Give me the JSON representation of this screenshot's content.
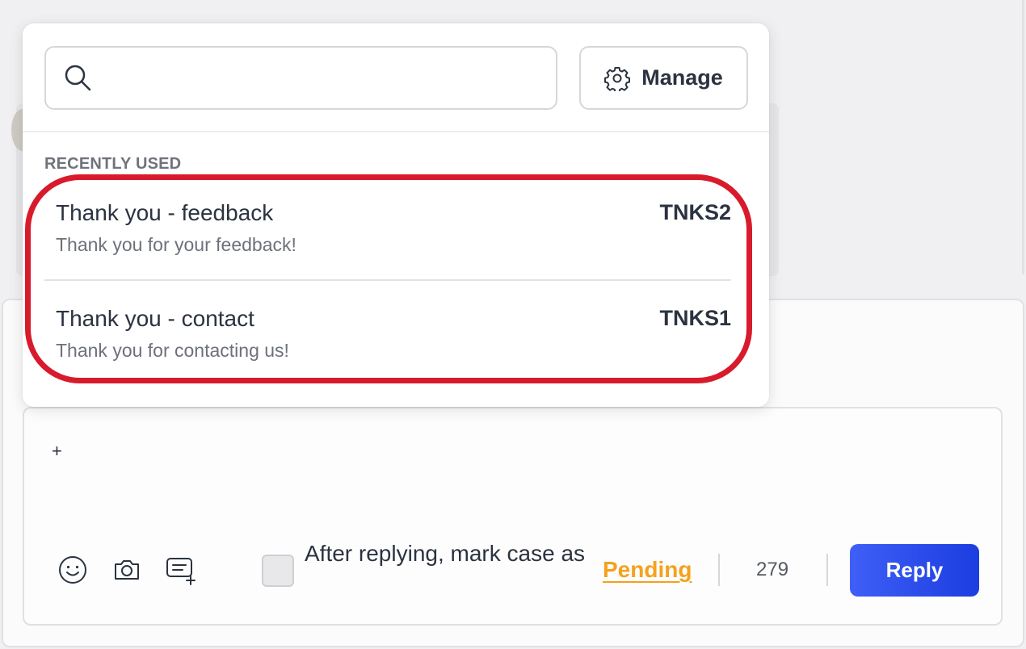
{
  "colors": {
    "accent": "#2f4ef0",
    "pending": "#f5a11c",
    "highlight": "#d81b2c"
  },
  "template_picker": {
    "search": {
      "value": "",
      "placeholder": ""
    },
    "manage_label": "Manage",
    "section_title": "RECENTLY USED",
    "templates": [
      {
        "title": "Thank you - feedback",
        "body": "Thank you for your feedback!",
        "code": "TNKS2"
      },
      {
        "title": "Thank you - contact",
        "body": "Thank you for contacting us!",
        "code": "TNKS1"
      }
    ]
  },
  "editor": {
    "content": "+"
  },
  "footer": {
    "icons": [
      "emoji-icon",
      "camera-icon",
      "template-icon"
    ],
    "mark_case_label": "After replying, mark case as",
    "status_value": "Pending",
    "char_count": "279",
    "reply_label": "Reply"
  }
}
